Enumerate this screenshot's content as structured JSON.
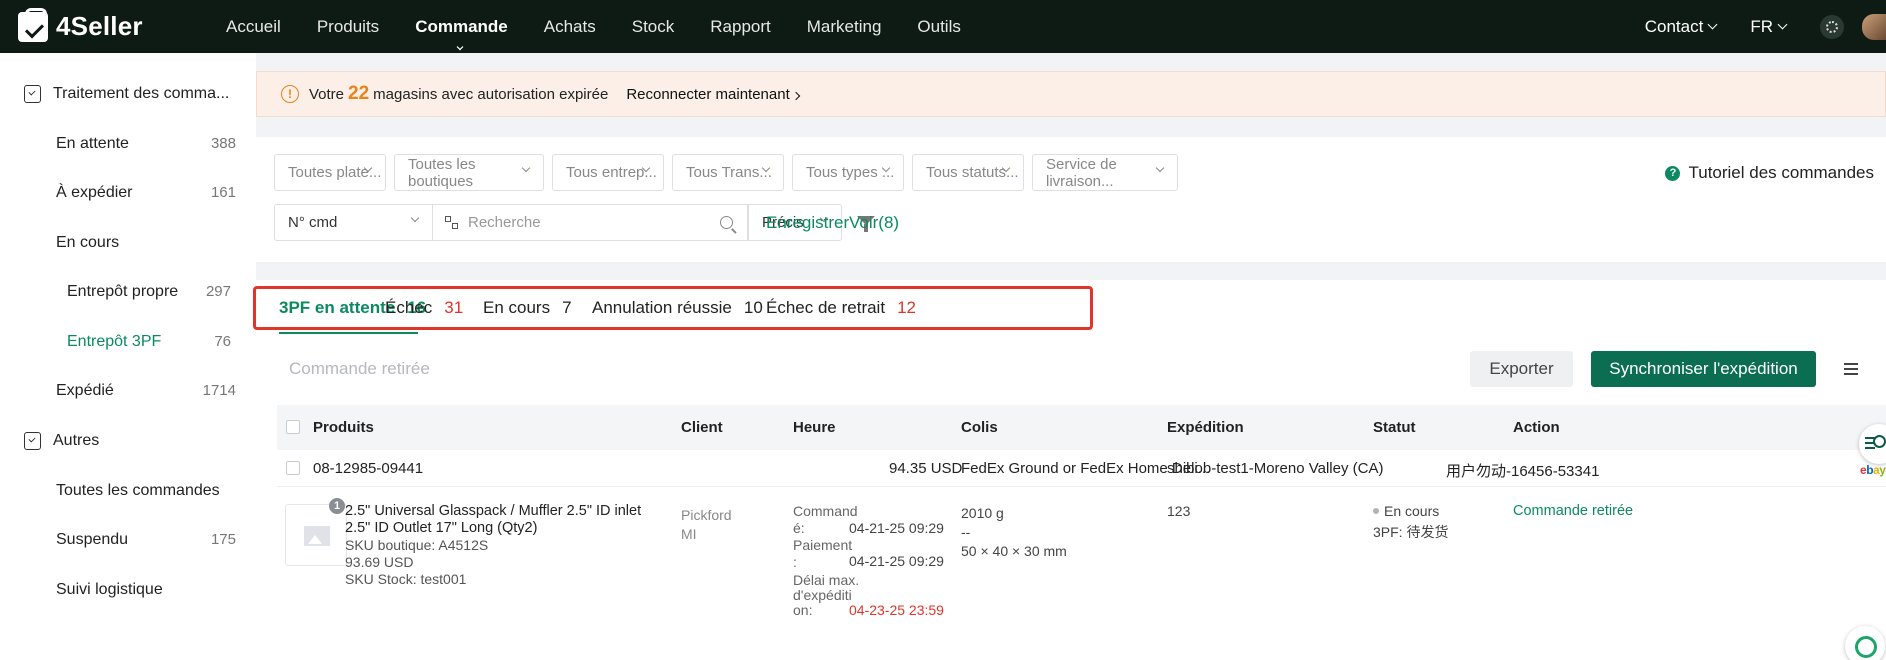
{
  "app": {
    "logo_text": "4Seller"
  },
  "nav": {
    "items": [
      "Accueil",
      "Produits",
      "Commande",
      "Achats",
      "Stock",
      "Rapport",
      "Marketing",
      "Outils"
    ],
    "active_index": 2
  },
  "topright": {
    "contact": "Contact",
    "lang": "FR"
  },
  "sidebar": {
    "group1_label": "Traitement des comma...",
    "items": [
      {
        "label": "En attente",
        "count": "388"
      },
      {
        "label": "À expédier",
        "count": "161"
      },
      {
        "label": "En cours",
        "count": ""
      },
      {
        "label": "Entrepôt propre",
        "count": "297"
      },
      {
        "label": "Entrepôt 3PF",
        "count": "76"
      },
      {
        "label": "Expédié",
        "count": "1714"
      }
    ],
    "group2_label": "Autres",
    "others": [
      {
        "label": "Toutes les commandes",
        "count": ""
      },
      {
        "label": "Suspendu",
        "count": "175"
      },
      {
        "label": "Suivi logistique",
        "count": ""
      }
    ]
  },
  "alert": {
    "prefix": "Votre",
    "count": "22",
    "suffix": "magasins avec autorisation expirée",
    "action": "Reconnecter maintenant"
  },
  "filters": {
    "selects": [
      "Toutes plate...",
      "Toutes les boutiques",
      "Tous entrep...",
      "Tous Trans...",
      "Tous types ...",
      "Tous statuts...",
      "Service de livraison..."
    ],
    "tutorial": "Tutoriel des commandes",
    "search_type": "N° cmd",
    "search_placeholder": "Recherche",
    "match_mode": "Précis",
    "save": "Enregistrer",
    "view": "Voir(8)"
  },
  "tabs": [
    {
      "label": "3PF en attente",
      "count": "16"
    },
    {
      "label": "Échec",
      "count": "31"
    },
    {
      "label": "En cours",
      "count": "7"
    },
    {
      "label": "Annulation réussie",
      "count": "10"
    },
    {
      "label": "Échec de retrait",
      "count": "12"
    }
  ],
  "toolbar": {
    "retiree": "Commande retirée",
    "export": "Exporter",
    "sync": "Synchroniser l'expédition"
  },
  "table": {
    "headers": [
      "Produits",
      "Client",
      "Heure",
      "Colis",
      "Expédition",
      "Statut",
      "Action"
    ],
    "order": {
      "id": "08-12985-09441",
      "amount": "94.35 USD",
      "carrier": "FedEx Ground or FedEx Home Deli...",
      "warehouse": "shibob-test1-Moreno Valley (CA)",
      "buyer": "用户勿动-16456-53341",
      "platform": "ebay"
    },
    "item": {
      "qty_badge": "1",
      "title": "2.5\" Universal Glasspack / Muffler 2.5\" ID inlet 2.5\" ID Outlet 17\" Long (Qty2)",
      "sku_shop": "SKU boutique: A4512S",
      "price": "93.69 USD",
      "sku_stock": "SKU Stock: test001",
      "client_name": "Pickford",
      "client_state": "MI",
      "time_label_1a": "Command",
      "time_label_1b": "é:",
      "time_val_1": "04-21-25 09:29",
      "time_label_2a": "Paiement",
      "time_label_2b": ":",
      "time_val_2": "04-21-25 09:29",
      "time_label_3a": "Délai max.",
      "time_label_3b": "d'expéditi",
      "time_label_3c": "on:",
      "time_val_3": "04-23-25 23:59",
      "weight": "2010 g",
      "dash": "--",
      "dims": "50 × 40 × 30 mm",
      "tracking": "123",
      "status": "En cours",
      "status_3pf": "3PF: 待发货",
      "action": "Commande retirée"
    }
  },
  "colors": {
    "brand_green": "#0b8a62",
    "header_dark": "#0d1b14",
    "alert_orange": "#e8841a",
    "red": "#e0352b"
  }
}
